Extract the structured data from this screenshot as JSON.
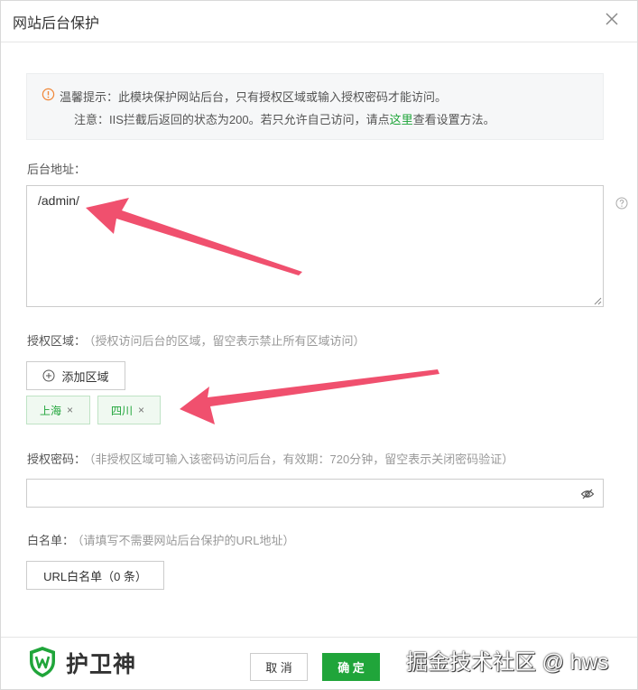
{
  "dialog": {
    "title": "网站后台保护"
  },
  "notice": {
    "line1": "温馨提示：此模块保护网站后台，只有授权区域或输入授权密码才能访问。",
    "line2_prefix": "注意：IIS拦截后返回的状态为200。若只允许自己访问，请点",
    "line2_link": "这里",
    "line2_suffix": "查看设置方法。"
  },
  "backend_address": {
    "label": "后台地址：",
    "value": "/admin/"
  },
  "authorized_regions": {
    "label": "授权区域：",
    "hint": "（授权访问后台的区域，留空表示禁止所有区域访问）",
    "add_button": "添加区域",
    "tags": [
      {
        "label": "上海",
        "close": "×"
      },
      {
        "label": "四川",
        "close": "×"
      }
    ]
  },
  "auth_password": {
    "label": "授权密码：",
    "hint": "（非授权区域可输入该密码访问后台，有效期：720分钟，留空表示关闭密码验证）",
    "value": ""
  },
  "whitelist": {
    "label": "白名单：",
    "hint": "（请填写不需要网站后台保护的URL地址）",
    "button": "URL白名单（0 条）"
  },
  "footer": {
    "brand": "护卫神",
    "cancel": "取 消",
    "confirm": "确 定",
    "watermark": "掘金技术社区 @ hws"
  },
  "colors": {
    "accent": "#20a53a",
    "warning": "#f0883a",
    "arrow": "#f0506e"
  },
  "icons": {
    "close": "close-icon",
    "warning": "warning-icon",
    "help": "help-icon",
    "add": "plus-circle-icon",
    "eye": "eye-slash-icon",
    "logo": "shield-w-icon"
  }
}
